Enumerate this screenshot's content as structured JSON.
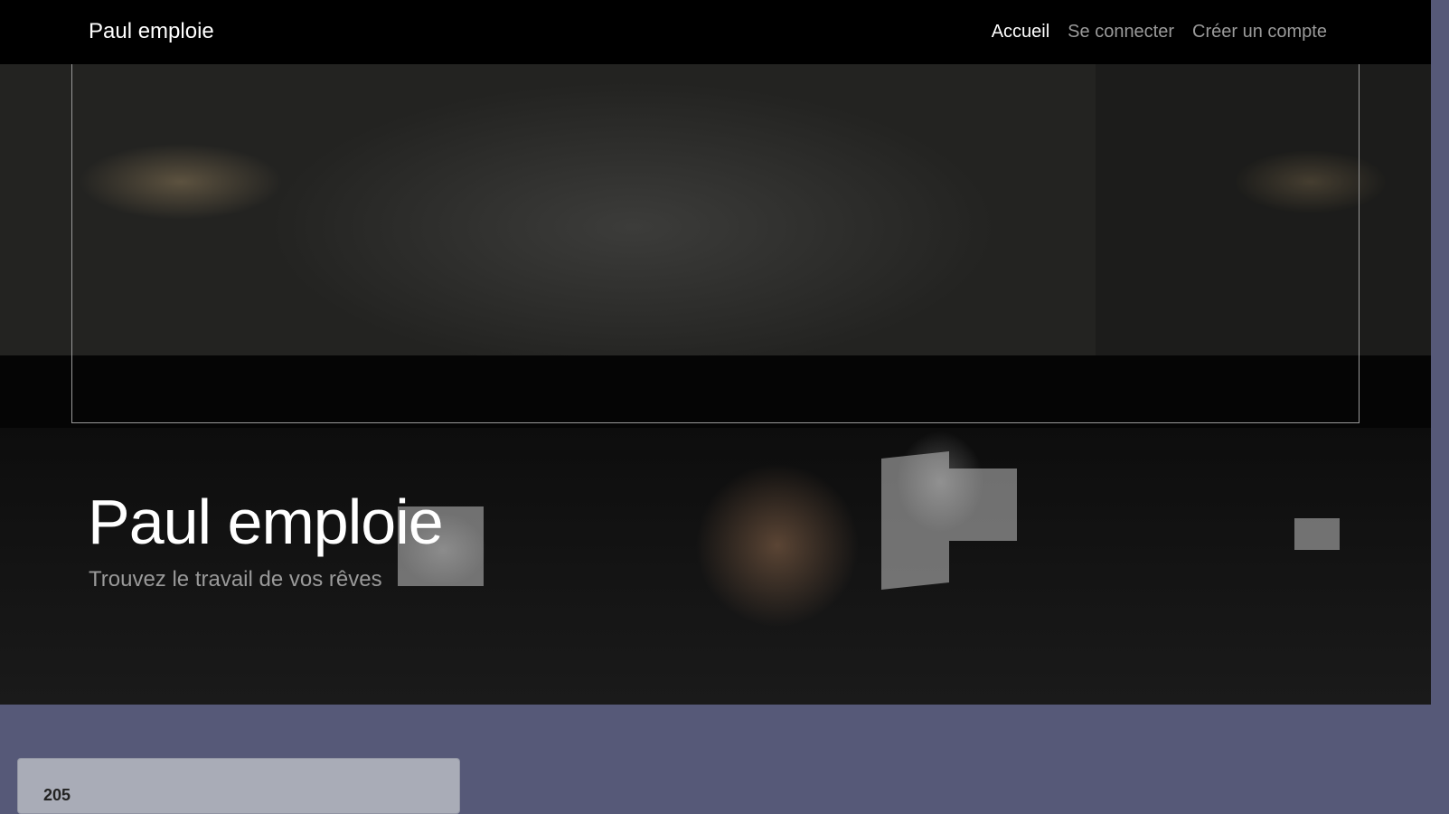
{
  "nav": {
    "brand": "Paul emploie",
    "links": [
      {
        "label": "Accueil",
        "active": true
      },
      {
        "label": "Se connecter",
        "active": false
      },
      {
        "label": "Créer un compte",
        "active": false
      }
    ]
  },
  "hero": {
    "title": "Paul emploie",
    "subtitle": "Trouvez le travail de vos rêves"
  },
  "card": {
    "partial_text": "205"
  },
  "colors": {
    "page_background": "#565978",
    "navbar_background": "#000000",
    "nav_active": "#ffffff",
    "nav_inactive": "#9a9a9a"
  }
}
